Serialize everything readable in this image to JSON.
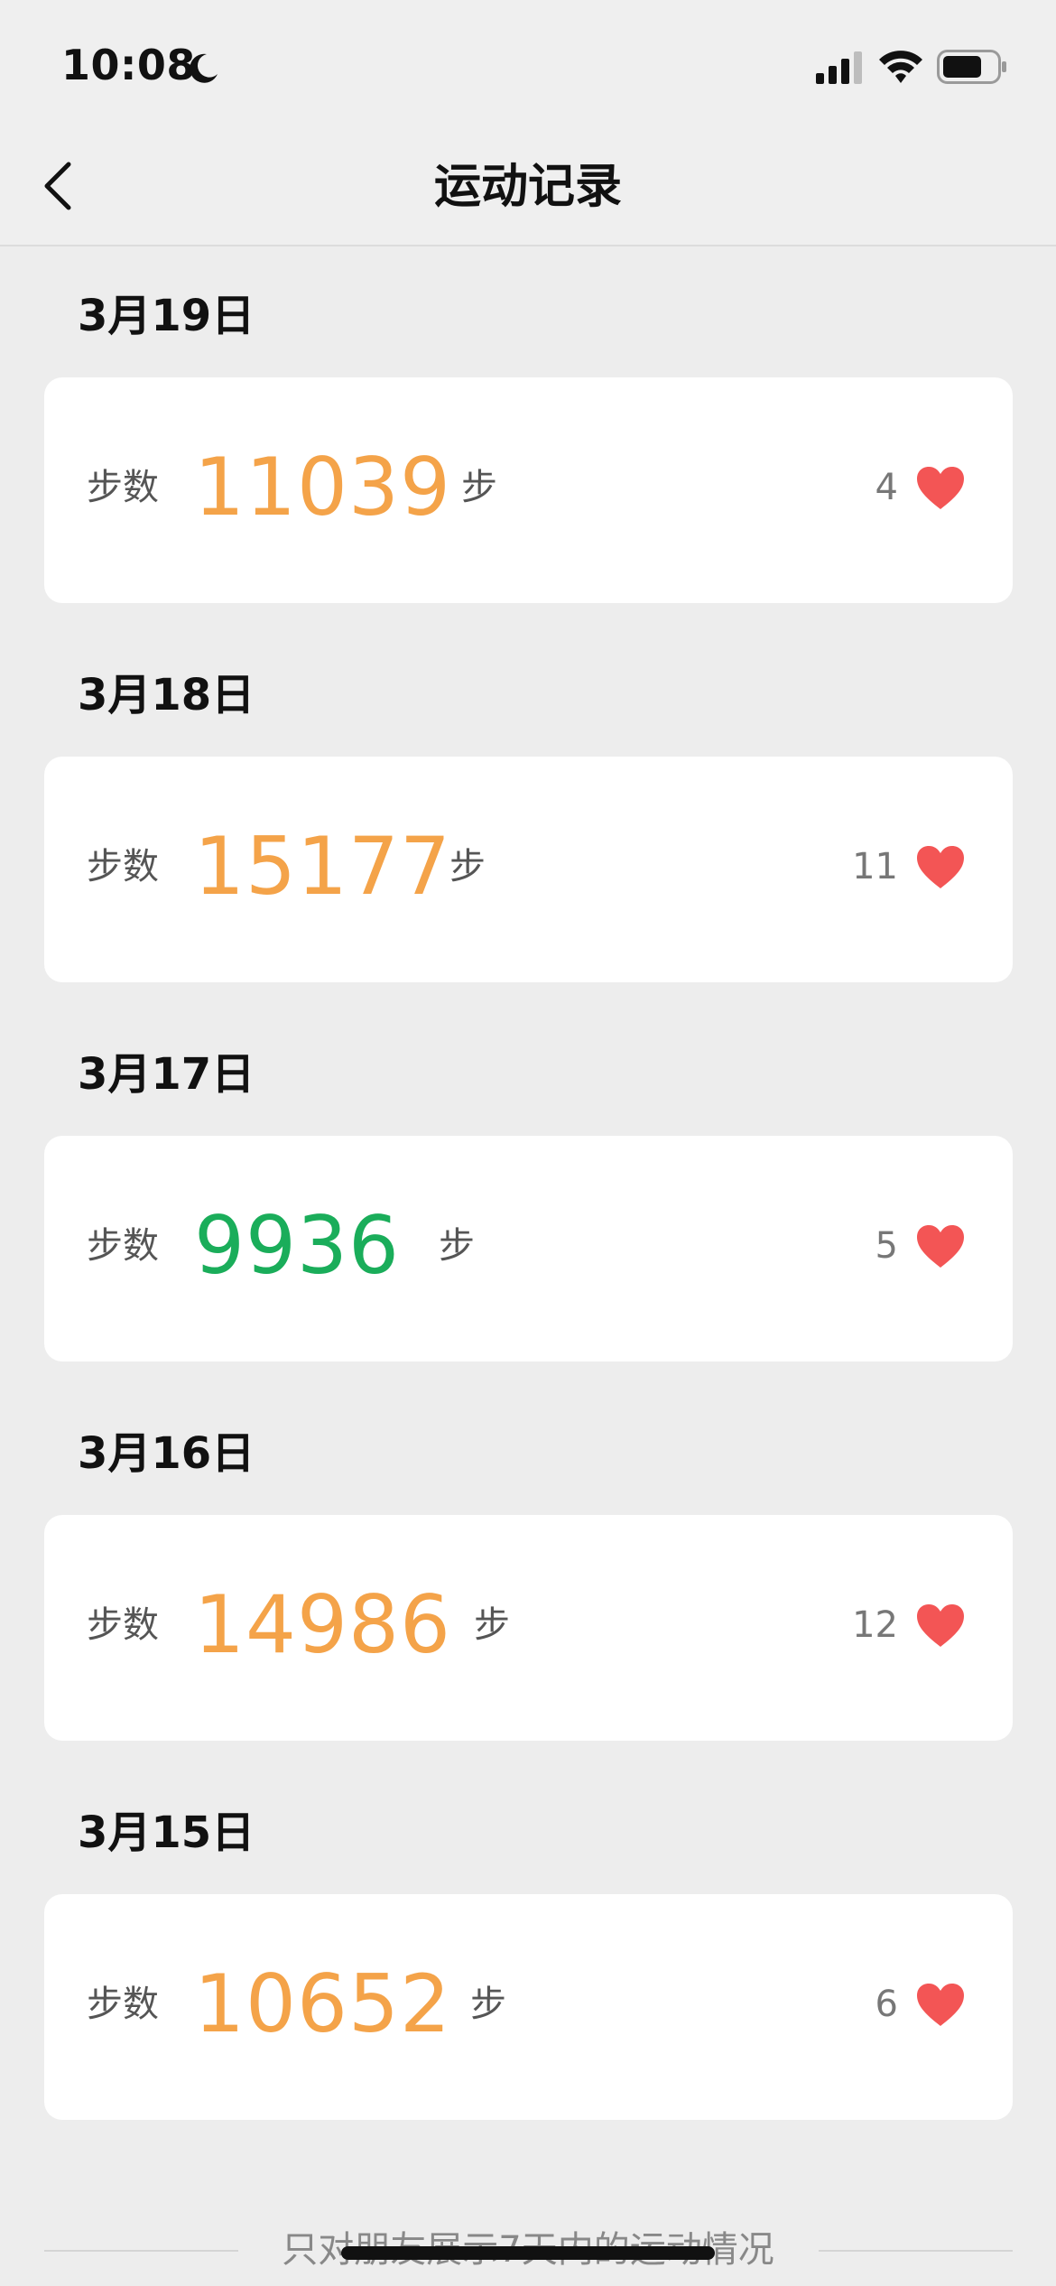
{
  "status_bar": {
    "time": "10:08"
  },
  "nav": {
    "title": "运动记录"
  },
  "colors": {
    "orange": "#f4a349",
    "green": "#1aad5a",
    "heart": "#f35555"
  },
  "records": [
    {
      "date": "3月19日",
      "label": "步数",
      "steps": "11039",
      "unit": "步",
      "likes": "4",
      "color": "orange"
    },
    {
      "date": "3月18日",
      "label": "步数",
      "steps": "15177",
      "unit": "步",
      "likes": "11",
      "color": "orange"
    },
    {
      "date": "3月17日",
      "label": "步数",
      "steps": "9936",
      "unit": "步",
      "likes": "5",
      "color": "green"
    },
    {
      "date": "3月16日",
      "label": "步数",
      "steps": "14986",
      "unit": "步",
      "likes": "12",
      "color": "orange"
    },
    {
      "date": "3月15日",
      "label": "步数",
      "steps": "10652",
      "unit": "步",
      "likes": "6",
      "color": "orange"
    }
  ],
  "footer": {
    "note": "只对朋友展示7天内的运动情况"
  }
}
